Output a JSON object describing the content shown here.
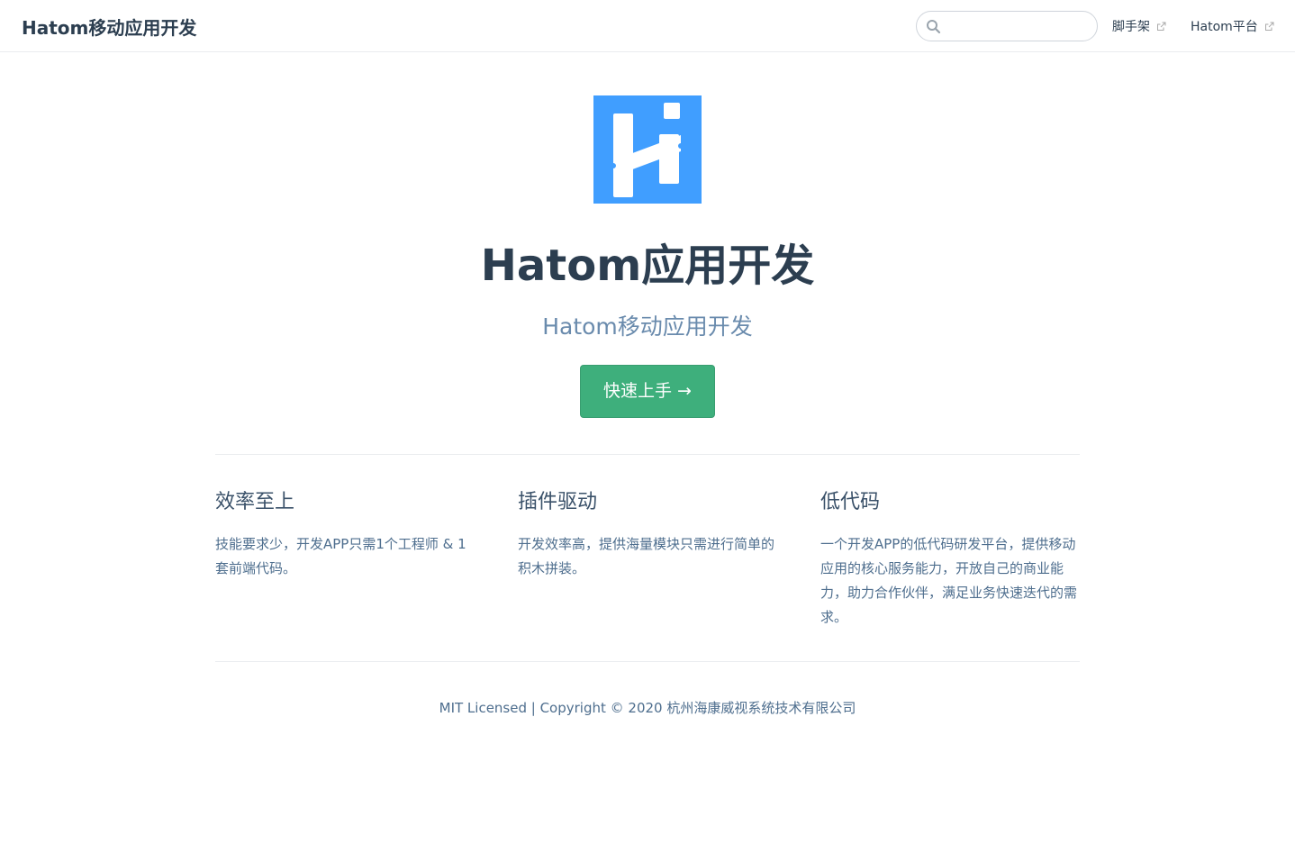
{
  "navbar": {
    "site_name": "Hatom移动应用开发",
    "search": {
      "value": "",
      "placeholder": "",
      "icon": "search-icon"
    },
    "links": [
      {
        "label": "脚手架",
        "icon": "external-link-icon"
      },
      {
        "label": "Hatom平台",
        "icon": "external-link-icon"
      }
    ]
  },
  "hero": {
    "logo_icon": "hatom-logo-icon",
    "title": "Hatom应用开发",
    "description": "Hatom移动应用开发",
    "action_label": "快速上手 →"
  },
  "features": [
    {
      "title": "效率至上",
      "details": "技能要求少，开发APP只需1个工程师 & 1套前端代码。"
    },
    {
      "title": "插件驱动",
      "details": "开发效率高，提供海量模块只需进行简单的积木拼装。"
    },
    {
      "title": "低代码",
      "details": "一个开发APP的低代码研发平台，提供移动应用的核心服务能力，开放自己的商业能力，助力合作伙伴，满足业务快速迭代的需求。"
    }
  ],
  "footer": {
    "text": "MIT Licensed | Copyright © 2020 杭州海康威视系统技术有限公司"
  },
  "colors": {
    "accent": "#3eaf7c",
    "logo_bg": "#409eff",
    "text": "#2c3e50",
    "description": "#6a8bad"
  }
}
